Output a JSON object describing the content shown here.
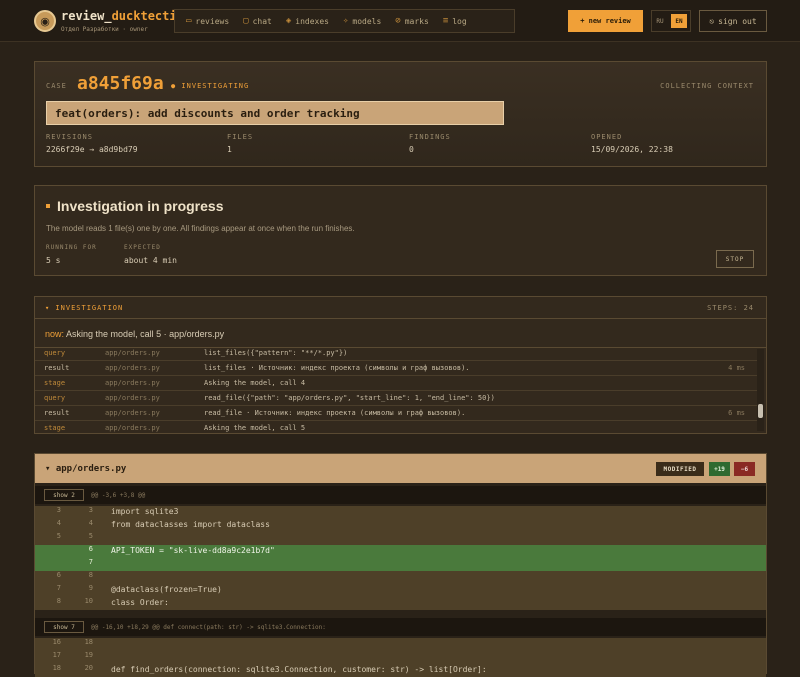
{
  "brand": {
    "name_prefix": "review_",
    "name_accent": "ducktective",
    "subtitle": "Отдел Разработки · owner"
  },
  "nav": [
    {
      "icon": "folder-icon",
      "glyph": "▭",
      "label": "reviews"
    },
    {
      "icon": "chat-icon",
      "glyph": "▢",
      "label": "chat"
    },
    {
      "icon": "layers-icon",
      "glyph": "◈",
      "label": "indexes"
    },
    {
      "icon": "cube-icon",
      "glyph": "✧",
      "label": "models"
    },
    {
      "icon": "mark-icon",
      "glyph": "⊘",
      "label": "marks"
    },
    {
      "icon": "list-icon",
      "glyph": "≡",
      "label": "log"
    }
  ],
  "actions": {
    "new_review": "+ new review",
    "lang_ru": "RU",
    "lang_en": "EN",
    "sign_out": "sign out"
  },
  "case": {
    "label": "CASE",
    "id": "a845f69a",
    "status": "● INVESTIGATING",
    "phase": "COLLECTING CONTEXT",
    "title": "feat(orders): add discounts and order tracking",
    "revisions_label": "REVISIONS",
    "revisions": "2266f29e → a8d9bd79",
    "files_label": "FILES",
    "files": "1",
    "findings_label": "FINDINGS",
    "findings": "0",
    "opened_label": "OPENED",
    "opened": "15/09/2026, 22:38"
  },
  "progress": {
    "title": "Investigation in progress",
    "text": "The model reads 1 file(s) one by one. All findings appear at once when the run finishes.",
    "running_label": "RUNNING FOR",
    "running": "5 s",
    "expected_label": "EXPECTED",
    "expected": "about 4 min",
    "stop": "STOP"
  },
  "investigation": {
    "header": "▾ INVESTIGATION",
    "steps": "STEPS: 24",
    "now_label": "now:",
    "now_text": "Asking the model, call 5 · app/orders.py",
    "rows": [
      {
        "type": "query",
        "file": "app/orders.py",
        "msg": "list_files({\"pattern\": \"**/*.py\"})",
        "dur": ""
      },
      {
        "type": "result",
        "file": "app/orders.py",
        "msg": "list_files · Источник: индекс проекта (символы и граф вызовов).",
        "dur": "4 ms"
      },
      {
        "type": "stage",
        "file": "app/orders.py",
        "msg": "Asking the model, call 4",
        "dur": ""
      },
      {
        "type": "query",
        "file": "app/orders.py",
        "msg": "read_file({\"path\": \"app/orders.py\", \"start_line\": 1, \"end_line\": 50})",
        "dur": ""
      },
      {
        "type": "result",
        "file": "app/orders.py",
        "msg": "read_file · Источник: индекс проекта (символы и граф вызовов).",
        "dur": "6 ms"
      },
      {
        "type": "stage",
        "file": "app/orders.py",
        "msg": "Asking the model, call 5",
        "dur": ""
      }
    ]
  },
  "diff": {
    "file": "▾ app/orders.py",
    "modified": "MODIFIED",
    "added": "+19",
    "removed": "−6",
    "hunk1_show": "show 2",
    "hunk1": "@@ -3,6 +3,8 @@",
    "hunk2_show": "show 7",
    "hunk2": "@@ -16,10 +18,29 @@ def connect(path: str) -> sqlite3.Connection:",
    "lines1": [
      {
        "old": "3",
        "new": "3",
        "code": "import sqlite3",
        "kind": "ctx"
      },
      {
        "old": "4",
        "new": "4",
        "code": "from dataclasses import dataclass",
        "kind": "ctx"
      },
      {
        "old": "5",
        "new": "5",
        "code": "",
        "kind": "ctx"
      },
      {
        "old": "",
        "new": "6",
        "code": "API_TOKEN = \"sk-live-dd8a9c2e1b7d\"",
        "kind": "add"
      },
      {
        "old": "",
        "new": "7",
        "code": "",
        "kind": "add"
      },
      {
        "old": "6",
        "new": "8",
        "code": "",
        "kind": "ctx"
      },
      {
        "old": "7",
        "new": "9",
        "code": "@dataclass(frozen=True)",
        "kind": "ctx"
      },
      {
        "old": "8",
        "new": "10",
        "code": "class Order:",
        "kind": "ctx"
      }
    ],
    "lines2": [
      {
        "old": "16",
        "new": "18",
        "code": "",
        "kind": "ctx"
      },
      {
        "old": "17",
        "new": "19",
        "code": "",
        "kind": "ctx"
      },
      {
        "old": "18",
        "new": "20",
        "code": "def find_orders(connection: sqlite3.Connection, customer: str) -> list[Order]:",
        "kind": "ctx"
      }
    ]
  },
  "colors": {
    "accent": "#f0a038",
    "bg": "#2a2218",
    "added": "#4a7a3c",
    "removed": "#8a2a24"
  }
}
